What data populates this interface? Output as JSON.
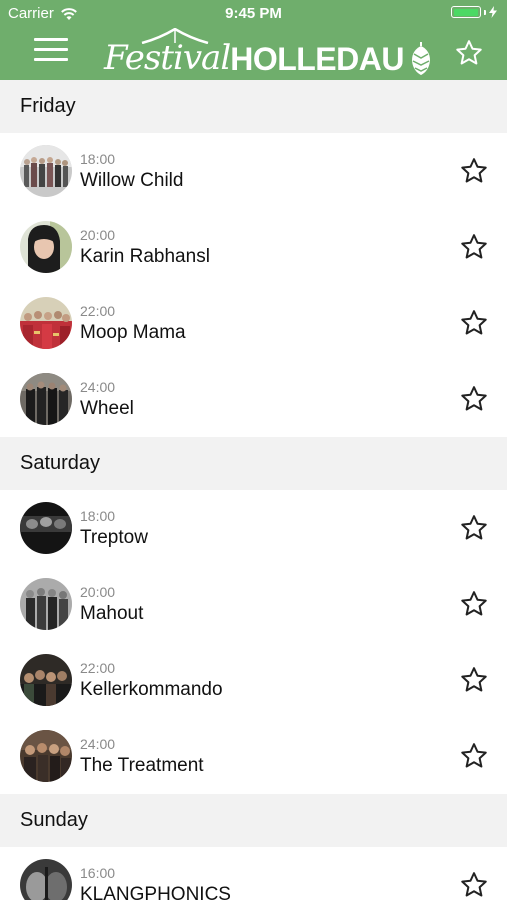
{
  "status_bar": {
    "carrier": "Carrier",
    "time": "9:45 PM"
  },
  "header": {
    "logo_script": "Festival",
    "logo_caps": "HOLLEDAU"
  },
  "colors": {
    "header_green": "#6fae6c",
    "section_bg": "#f2f2f2",
    "time_gray": "#8a8a8a"
  },
  "sections": [
    {
      "day": "Friday",
      "items": [
        {
          "time": "18:00",
          "name": "Willow Child"
        },
        {
          "time": "20:00",
          "name": "Karin Rabhansl"
        },
        {
          "time": "22:00",
          "name": "Moop Mama"
        },
        {
          "time": "24:00",
          "name": "Wheel"
        }
      ]
    },
    {
      "day": "Saturday",
      "items": [
        {
          "time": "18:00",
          "name": "Treptow"
        },
        {
          "time": "20:00",
          "name": "Mahout"
        },
        {
          "time": "22:00",
          "name": "Kellerkommando"
        },
        {
          "time": "24:00",
          "name": "The Treatment"
        }
      ]
    },
    {
      "day": "Sunday",
      "items": [
        {
          "time": "16:00",
          "name": "KLANGPHONICS"
        }
      ]
    }
  ]
}
